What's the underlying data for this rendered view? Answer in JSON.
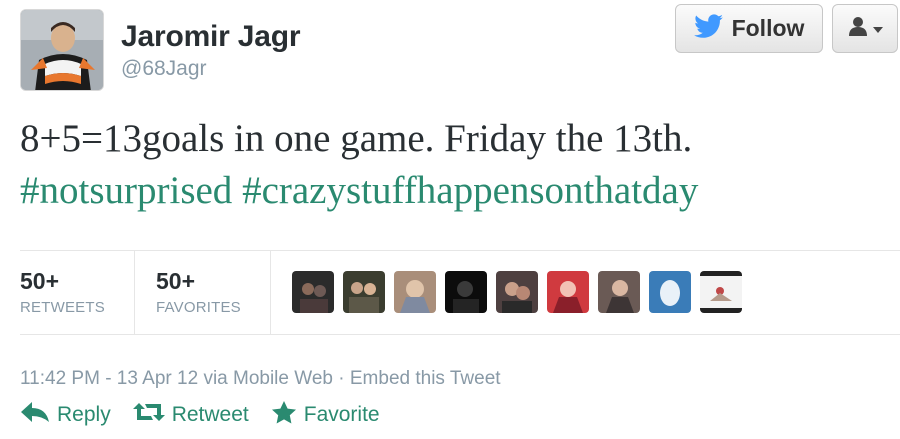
{
  "author": {
    "name": "Jaromir Jagr",
    "handle": "@68Jagr"
  },
  "header": {
    "follow_label": "Follow"
  },
  "tweet": {
    "text": "8+5=13goals in one game. Friday the 13th.",
    "hashtags": [
      "#notsurprised",
      "#crazystuffhappensonthatday"
    ]
  },
  "stats": {
    "retweets": {
      "count": "50+",
      "label": "RETWEETS"
    },
    "favorites": {
      "count": "50+",
      "label": "FAVORITES"
    }
  },
  "meta": {
    "timestamp": "11:42 PM - 13 Apr 12",
    "via": "via Mobile Web",
    "separator": "·",
    "embed": "Embed this Tweet"
  },
  "actions": {
    "reply": "Reply",
    "retweet": "Retweet",
    "favorite": "Favorite"
  },
  "colors": {
    "accent": "#2a8a70",
    "meta": "#8899a6",
    "twitter_blue": "#4099ff"
  }
}
